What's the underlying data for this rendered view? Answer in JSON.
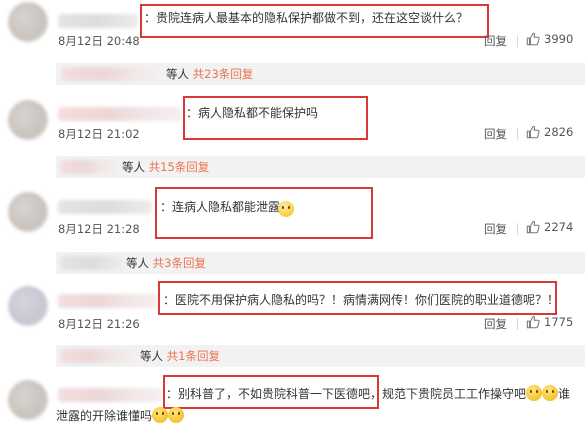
{
  "comments": [
    {
      "text": "：贵院连病人最基本的隐私保护都做不到，还在这空谈什么？",
      "time": "8月12日 20:48",
      "reply": "回复",
      "likes": "3990",
      "sub_who": "等人",
      "sub_count": "共23条回复"
    },
    {
      "text": "：病人隐私都不能保护吗",
      "time": "8月12日 21:02",
      "reply": "回复",
      "likes": "2826",
      "sub_who": "等人",
      "sub_count": "共15条回复"
    },
    {
      "text": "：连病人隐私都能泄露",
      "time": "8月12日 21:28",
      "reply": "回复",
      "likes": "2274",
      "sub_who": "等人",
      "sub_count": "共3条回复"
    },
    {
      "text": "：医院不用保护病人隐私的吗？！病情满网传！你们医院的职业道德呢？！",
      "time": "8月12日 21:26",
      "reply": "回复",
      "likes": "1775",
      "sub_who": "等人",
      "sub_count": "共1条回复"
    },
    {
      "text_boxed": "：别科普了，不如贵院科普一下医德吧",
      "text_rest": "，规范下贵院员工工作操守吧",
      "text_tail_a": "谁",
      "text_line2": "泄露的开除谁懂吗"
    }
  ],
  "icons": {
    "like": "thumbs-up-icon",
    "emoji": "smiley-emoji-icon"
  },
  "colors": {
    "highlight_box": "#d93838",
    "reply_count": "#eb7350",
    "sub_bg": "#f2f2f2"
  }
}
